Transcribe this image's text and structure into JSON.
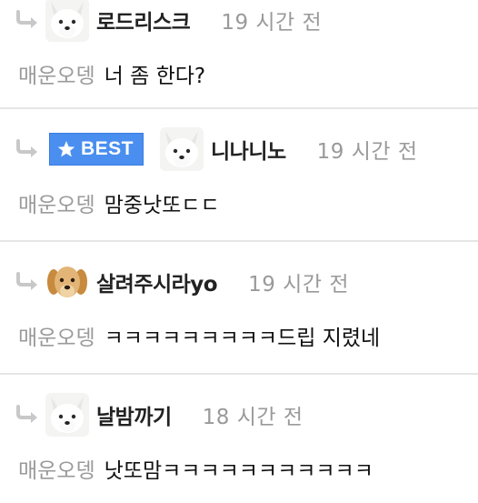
{
  "comments": [
    {
      "avatar": "arctic-fox",
      "best": false,
      "nickname": "로드리스크",
      "time": "19 시간 전",
      "mention": "매운오뎅",
      "text": "너 좀 한다?"
    },
    {
      "avatar": "arctic-fox",
      "best": true,
      "best_label": "BEST",
      "nickname": "니나니노",
      "time": "19 시간 전",
      "mention": "매운오뎅",
      "text": "맘중낫또ㄷㄷ"
    },
    {
      "avatar": "puppy",
      "best": false,
      "nickname": "살려주시라yo",
      "time": "19 시간 전",
      "mention": "매운오뎅",
      "text": "ㅋㅋㅋㅋㅋㅋㅋㅋㅋ드립 지렸네"
    },
    {
      "avatar": "arctic-fox",
      "best": false,
      "nickname": "날밤까기",
      "time": "18 시간 전",
      "mention": "매운오뎅",
      "text": "낫또맘ㅋㅋㅋㅋㅋㅋㅋㅋㅋㅋㅋ"
    }
  ],
  "colors": {
    "best_badge": "#4a8ff0",
    "reply_arrow": "#c8c8c8",
    "mention": "#9a9a9a",
    "time": "#9a9a9a",
    "divider": "#e5e5e5"
  },
  "icons": {
    "reply": "reply-arrow-icon",
    "best": "star-icon"
  }
}
